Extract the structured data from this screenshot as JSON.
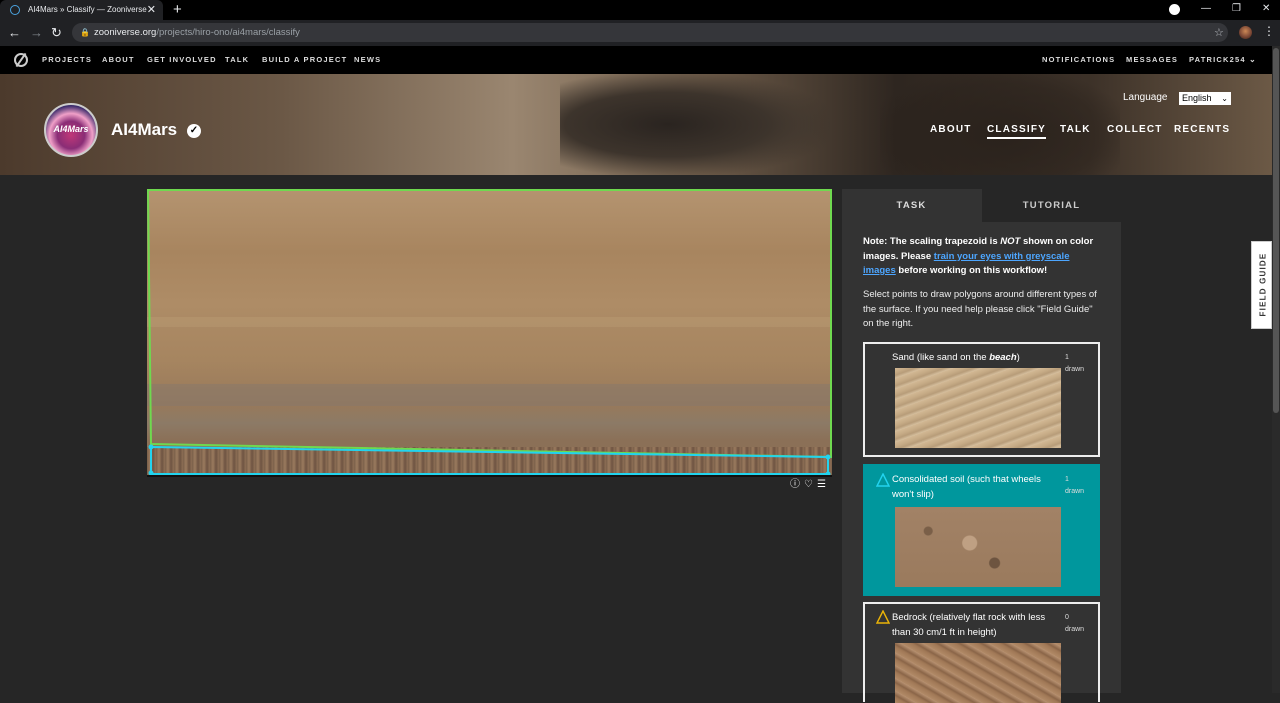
{
  "browser": {
    "tab_title": "AI4Mars » Classify — Zooniverse",
    "tab_close": "✕",
    "new_tab": "+",
    "url_host": "zooniverse.org",
    "url_path": "/projects/hiro-ono/ai4mars/classify",
    "icons": [
      "back-arrow-icon",
      "forward-arrow-icon",
      "reload-icon",
      "lock-icon",
      "star-icon",
      "kebab-menu-icon"
    ]
  },
  "zoonav": {
    "links": [
      "PROJECTS",
      "ABOUT",
      "GET INVOLVED",
      "TALK",
      "BUILD A PROJECT",
      "NEWS"
    ],
    "right_links": [
      "NOTIFICATIONS",
      "MESSAGES",
      "PATRICK254"
    ]
  },
  "project": {
    "title": "AI4Mars",
    "avatar_text": "AI4Mars",
    "language_label": "Language",
    "language_value": "English",
    "nav": [
      "ABOUT",
      "CLASSIFY",
      "TALK",
      "COLLECT",
      "RECENTS"
    ],
    "active_nav": "CLASSIFY"
  },
  "panel": {
    "tabs": [
      "TASK",
      "TUTORIAL"
    ],
    "note_prefix": "Note: The scaling trapezoid is ",
    "note_not": "NOT",
    "note_mid": " shown on color images. Please ",
    "note_link": "train your eyes with greyscale images",
    "note_suffix": " before working on this workflow!",
    "instructions": "Select points to draw polygons around different types of the surface. If you need help please click \"Field Guide\" on the right.",
    "options": [
      {
        "label_prefix": "Sand (like sand on the ",
        "label_em": "beach",
        "label_suffix": ")",
        "count": "1",
        "count_label": "drawn",
        "color": "#22c55e",
        "selected": false
      },
      {
        "label": "Consolidated soil (such that wheels won't slip)",
        "count": "1",
        "count_label": "drawn",
        "color": "#22d3ee",
        "selected": true
      },
      {
        "label": "Bedrock (relatively flat rock with less than 30 cm/1 ft in height)",
        "count": "0",
        "count_label": "drawn",
        "color": "#eab308",
        "selected": false
      }
    ]
  },
  "field_guide_label": "FIELD GUIDE",
  "accent_colors": {
    "sand_polygon": "#6fd94f",
    "soil_polygon": "#22d3ee",
    "selected_option": "#00979d"
  }
}
